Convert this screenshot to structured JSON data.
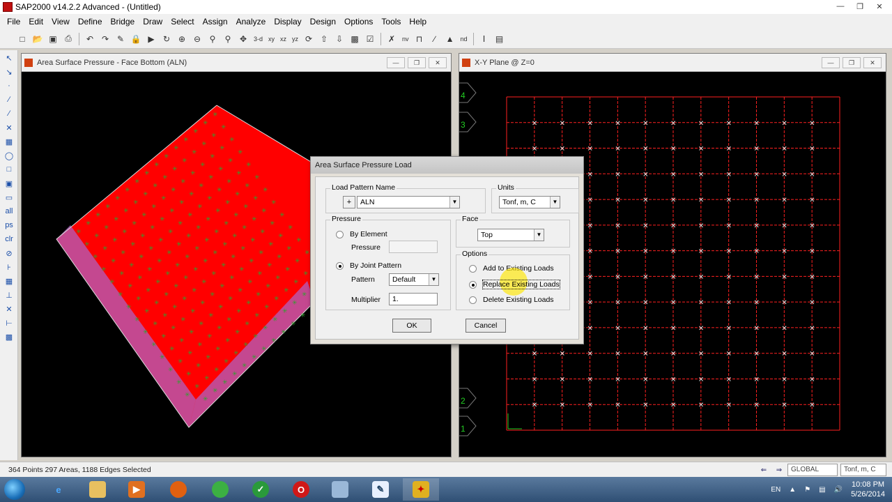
{
  "app": {
    "title": "SAP2000 v14.2.2 Advanced  - (Untitled)"
  },
  "menu": [
    "File",
    "Edit",
    "View",
    "Define",
    "Bridge",
    "Draw",
    "Select",
    "Assign",
    "Analyze",
    "Display",
    "Design",
    "Options",
    "Tools",
    "Help"
  ],
  "toolbar": {
    "labels": [
      "3-d",
      "xy",
      "xz",
      "yz",
      "nv",
      "nd"
    ]
  },
  "left_window": {
    "title": "Area Surface Pressure - Face Bottom (ALN)"
  },
  "right_window": {
    "title": "X-Y Plane @ Z=0",
    "grid_labels": [
      "4",
      "3",
      "2",
      "1"
    ]
  },
  "dialog": {
    "title": "Area Surface Pressure Load",
    "load_pattern_group": "Load Pattern Name",
    "load_pattern_value": "ALN",
    "units_group": "Units",
    "units_value": "Tonf, m, C",
    "pressure_group": "Pressure",
    "by_element_label": "By Element",
    "pressure_label": "Pressure",
    "pressure_value": "",
    "by_joint_label": "By Joint Pattern",
    "pattern_label": "Pattern",
    "pattern_value": "Default",
    "multiplier_label": "Multiplier",
    "multiplier_value": "1.",
    "face_group": "Face",
    "face_value": "Top",
    "options_group": "Options",
    "add_label": "Add to Existing Loads",
    "replace_label": "Replace Existing Loads",
    "delete_label": "Delete Existing Loads",
    "ok_label": "OK",
    "cancel_label": "Cancel",
    "plus": "+"
  },
  "status": {
    "text": "364 Points  297 Areas, 1188 Edges Selected",
    "coord_system": "GLOBAL",
    "units": "Tonf, m, C"
  },
  "taskbar": {
    "language": "EN",
    "time": "10:08 PM",
    "date": "5/26/2014"
  },
  "colors": {
    "accent": "#ff0000",
    "grid": "#ff2020",
    "load_arrows": "#e0e0e0",
    "model_fill": "#ff0000",
    "load_marks": "#2ea02e"
  }
}
